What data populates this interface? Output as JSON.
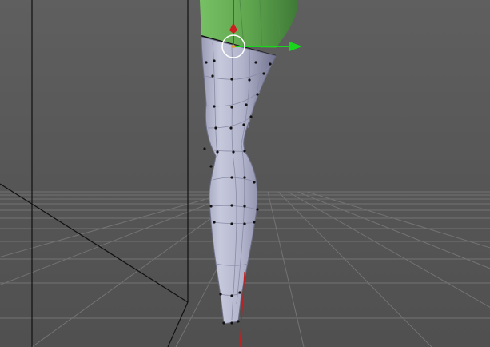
{
  "viewport": {
    "view": "perspective",
    "background_color": "#5a5a5a",
    "grid_color": "#6e6e6e",
    "mesh": {
      "name": "leg",
      "selected_color": "#aeb0c8",
      "shade_color": "#7e80a0",
      "upper_body_color": "#6cae5a",
      "vertex_color": "#111111"
    },
    "gizmo": {
      "type": "move",
      "x_axis_color": "#19d61c",
      "y_axis_color": "#cc2020",
      "z_axis_color": "#2a55e0",
      "ring_color": "#ffffff"
    }
  }
}
